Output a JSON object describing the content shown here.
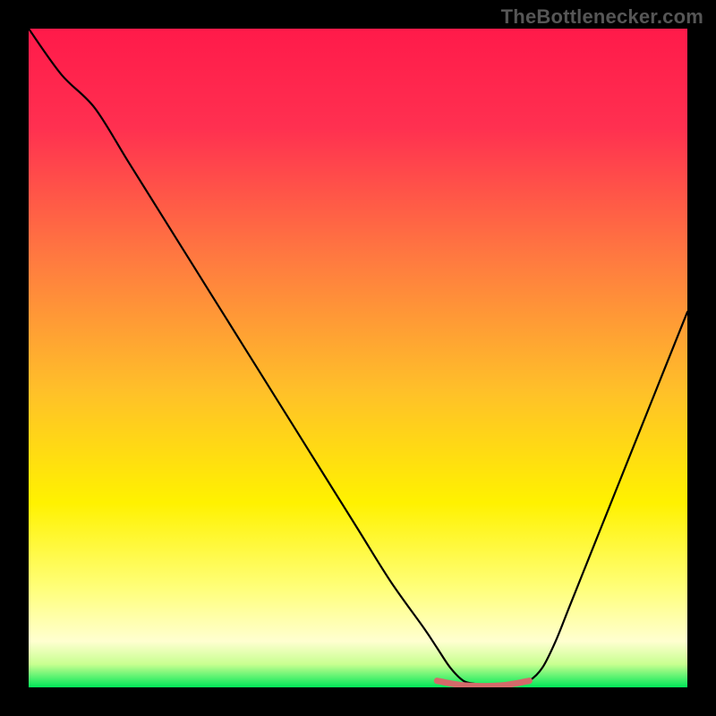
{
  "attribution": "TheBottlenecker.com",
  "chart_data": {
    "type": "line",
    "title": "",
    "xlabel": "",
    "ylabel": "",
    "xlim": [
      0,
      100
    ],
    "ylim": [
      0,
      100
    ],
    "grid": false,
    "series": [
      {
        "name": "curve",
        "x": [
          0,
          5,
          10,
          15,
          20,
          25,
          30,
          35,
          40,
          45,
          50,
          55,
          60,
          62,
          64,
          66,
          68,
          70,
          72,
          74,
          76,
          78,
          80,
          82,
          84,
          86,
          88,
          90,
          92,
          94,
          96,
          98,
          100
        ],
        "values": [
          100,
          93,
          88,
          80,
          72,
          64,
          56,
          48,
          40,
          32,
          24,
          16,
          9,
          6,
          3,
          1,
          0.5,
          0.2,
          0.2,
          0.5,
          1,
          3,
          7,
          12,
          17,
          22,
          27,
          32,
          37,
          42,
          47,
          52,
          57
        ]
      },
      {
        "name": "highlight",
        "x": [
          62,
          64,
          66,
          68,
          70,
          72,
          74,
          76
        ],
        "values": [
          1.0,
          0.6,
          0.3,
          0.2,
          0.2,
          0.3,
          0.6,
          1.0
        ]
      }
    ],
    "gradient_stops": [
      {
        "offset": 0.0,
        "color": "#ff1a4a"
      },
      {
        "offset": 0.15,
        "color": "#ff3050"
      },
      {
        "offset": 0.35,
        "color": "#ff7a40"
      },
      {
        "offset": 0.55,
        "color": "#ffc029"
      },
      {
        "offset": 0.72,
        "color": "#fff200"
      },
      {
        "offset": 0.85,
        "color": "#ffff7a"
      },
      {
        "offset": 0.93,
        "color": "#ffffd0"
      },
      {
        "offset": 0.965,
        "color": "#c8ff90"
      },
      {
        "offset": 1.0,
        "color": "#00e858"
      }
    ],
    "colors": {
      "curve": "#000000",
      "highlight": "#d46a6a",
      "background_top": "#ff1a4a",
      "background_bottom": "#00e858"
    }
  }
}
